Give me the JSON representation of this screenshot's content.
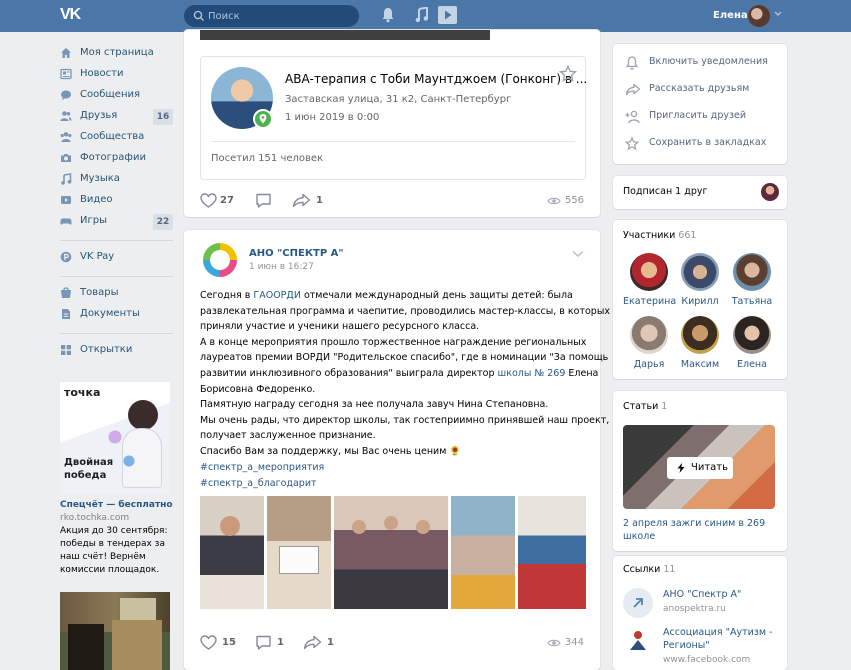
{
  "header": {
    "logo": "VK",
    "search_placeholder": "Поиск",
    "user_name": "Елена"
  },
  "nav": {
    "items": [
      {
        "label": "Моя страница",
        "icon": "home-icon"
      },
      {
        "label": "Новости",
        "icon": "news-icon"
      },
      {
        "label": "Сообщения",
        "icon": "messages-icon"
      },
      {
        "label": "Друзья",
        "icon": "friends-icon",
        "count": "16"
      },
      {
        "label": "Сообщества",
        "icon": "communities-icon"
      },
      {
        "label": "Фотографии",
        "icon": "camera-icon"
      },
      {
        "label": "Музыка",
        "icon": "music-icon"
      },
      {
        "label": "Видео",
        "icon": "video-icon"
      },
      {
        "label": "Игры",
        "icon": "gamepad-icon",
        "count": "22"
      },
      {
        "label": "VK Pay",
        "icon": "vkpay-icon"
      },
      {
        "label": "Товары",
        "icon": "goods-icon"
      },
      {
        "label": "Документы",
        "icon": "documents-icon"
      },
      {
        "label": "Открытки",
        "icon": "apps-icon"
      }
    ]
  },
  "ads": {
    "ad1": {
      "brand": "точка",
      "caption": "Двойная победа",
      "title": "Спецчёт — бесплатно",
      "domain": "rko.tochka.com",
      "description": "Акция до 30 сентября: победы в тендерах за наш счёт! Вернём комиссии площадок."
    }
  },
  "post1": {
    "event": {
      "title": "АВА-терапия с Тоби Маунтджоем (Гонконг) в ...",
      "address": "Заставская улица, 31 к2, Санкт-Петербург",
      "date": "1 июн 2019 в 0:00",
      "visits": "Посетил 151 человек"
    },
    "likes": "27",
    "shares": "1",
    "views": "556"
  },
  "post2": {
    "author": "АНО \"СПЕКТР А\"",
    "date": "1 июн в 16:27",
    "text_lines": [
      [
        "Сегодня в ",
        "ГАООРДИ",
        " отмечали международный день защиты детей: была"
      ],
      [
        "развлекательная программа и чаепитие, проводились мастер-классы, в которых"
      ],
      [
        "приняли участие и ученики нашего ресурсного класса."
      ],
      [
        "А в конце мероприятия прошло торжественное награждение региональных"
      ],
      [
        "лауреатов премии ВОРДИ \"Родительское спасибо\", где в номинации \"За помощь в"
      ],
      [
        "развитии инклюзивного образования\" выиграла директор ",
        "школы № 269",
        " Елена"
      ],
      [
        "Борисовна Федоренко."
      ],
      [
        "Памятную награду сегодня за нее получала завуч Нина Степановна."
      ],
      [
        "Мы очень рады, что директор школы, так гостеприимно принявшей наш проект,"
      ],
      [
        "получает заслуженное признание."
      ],
      [
        "Спасибо Вам за поддержку, мы Вас очень ценим 🌻"
      ]
    ],
    "hashtags": [
      "#спектр_а_мероприятия",
      "#спектр_а_благодарит"
    ],
    "likes": "15",
    "comments": "1",
    "shares": "1",
    "views": "344"
  },
  "right": {
    "actions": [
      {
        "label": "Включить уведомления",
        "icon": "bell-icon"
      },
      {
        "label": "Рассказать друзьям",
        "icon": "share-icon"
      },
      {
        "label": "Пригласить друзей",
        "icon": "invite-icon"
      },
      {
        "label": "Сохранить в закладках",
        "icon": "star-icon"
      }
    ],
    "subscribed": "Подписан 1 друг",
    "members_title": "Участники",
    "members_count": "661",
    "members": [
      "Екатерина",
      "Кирилл",
      "Татьяна",
      "Дарья",
      "Максим",
      "Елена"
    ],
    "articles_title": "Статьи",
    "articles_count": "1",
    "read_label": "Читать",
    "article_title": "2 апреля зажги синим в 269 школе",
    "links_title": "Ссылки",
    "links_count": "11",
    "links": [
      {
        "title": "АНО \"Спектр А\"",
        "url": "anospektra.ru"
      },
      {
        "title": "Ассоциация \"Аутизм -",
        "title2": "Регионы\"",
        "url": "www.facebook.com"
      }
    ]
  }
}
